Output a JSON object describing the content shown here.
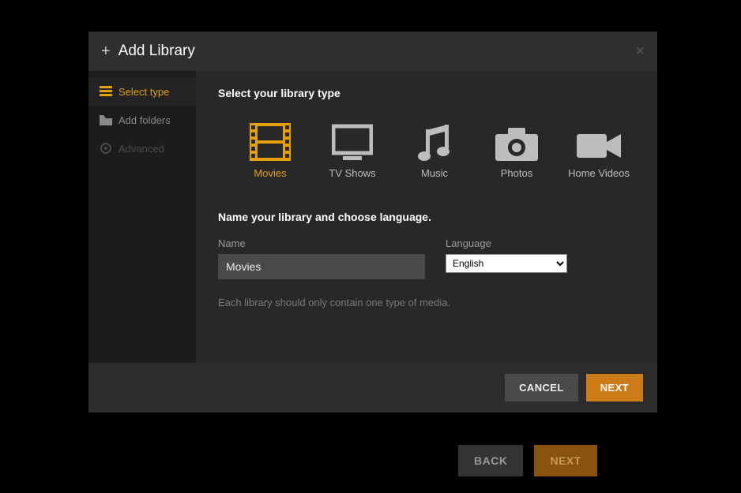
{
  "modal": {
    "title": "Add Library",
    "close_label": "×"
  },
  "sidebar": {
    "items": [
      {
        "label": "Select type",
        "icon": "stack"
      },
      {
        "label": "Add folders",
        "icon": "folder"
      },
      {
        "label": "Advanced",
        "icon": "gear"
      }
    ]
  },
  "content": {
    "heading_type": "Select your library type",
    "types": [
      {
        "label": "Movies",
        "icon": "film"
      },
      {
        "label": "TV Shows",
        "icon": "tv"
      },
      {
        "label": "Music",
        "icon": "music"
      },
      {
        "label": "Photos",
        "icon": "camera"
      },
      {
        "label": "Home Videos",
        "icon": "video"
      }
    ],
    "heading_name": "Name your library and choose language.",
    "name_label": "Name",
    "name_value": "Movies",
    "language_label": "Language",
    "language_value": "English",
    "hint": "Each library should only contain one type of media."
  },
  "footer": {
    "cancel": "CANCEL",
    "next": "NEXT"
  },
  "background_buttons": {
    "back": "BACK",
    "next": "NEXT"
  }
}
